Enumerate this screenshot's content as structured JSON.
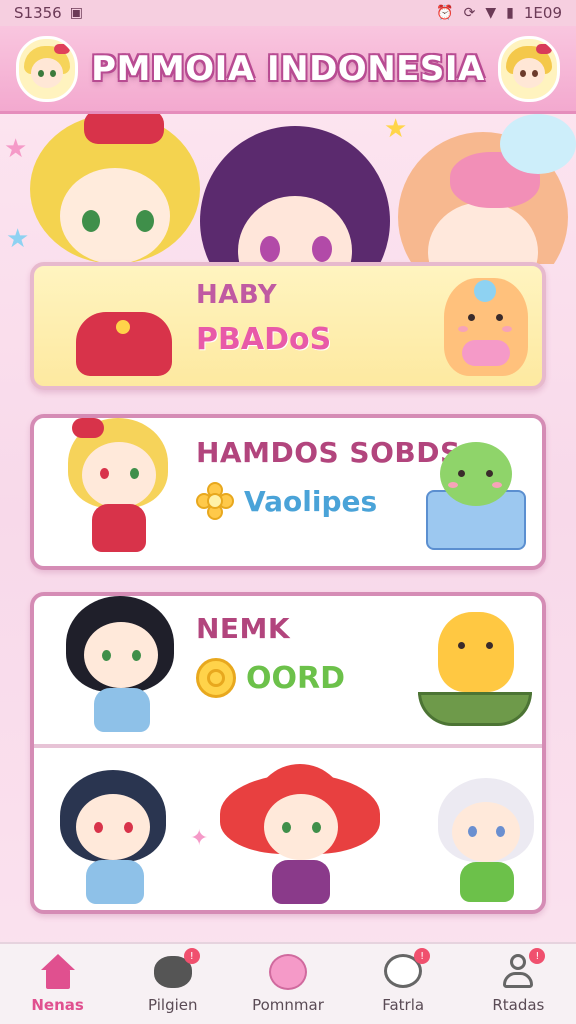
{
  "status_bar": {
    "time": "S1356",
    "clock": "1E09"
  },
  "header": {
    "title": "PMMOIA INDONESIA"
  },
  "cards": [
    {
      "title": "HABY",
      "subtitle": "PBADoS"
    },
    {
      "title": "HAMDOS SOBDS",
      "subtitle": "Vaolipes"
    },
    {
      "title": "NEMK",
      "subtitle": "OORD"
    }
  ],
  "nav": [
    {
      "label": "Nenas",
      "icon": "home-icon",
      "badge": ""
    },
    {
      "label": "Pilgien",
      "icon": "cat-face-icon",
      "badge": "!"
    },
    {
      "label": "Pomnmar",
      "icon": "pink-blob-icon",
      "badge": ""
    },
    {
      "label": "Fatrla",
      "icon": "smile-chat-icon",
      "badge": "!"
    },
    {
      "label": "Rtadas",
      "icon": "profile-icon",
      "badge": "!"
    }
  ],
  "colors": {
    "accent": "#e0508f",
    "header_pink": "#f3a9cf",
    "card_border": "#d58cb5",
    "title_text": "#b2457d"
  }
}
